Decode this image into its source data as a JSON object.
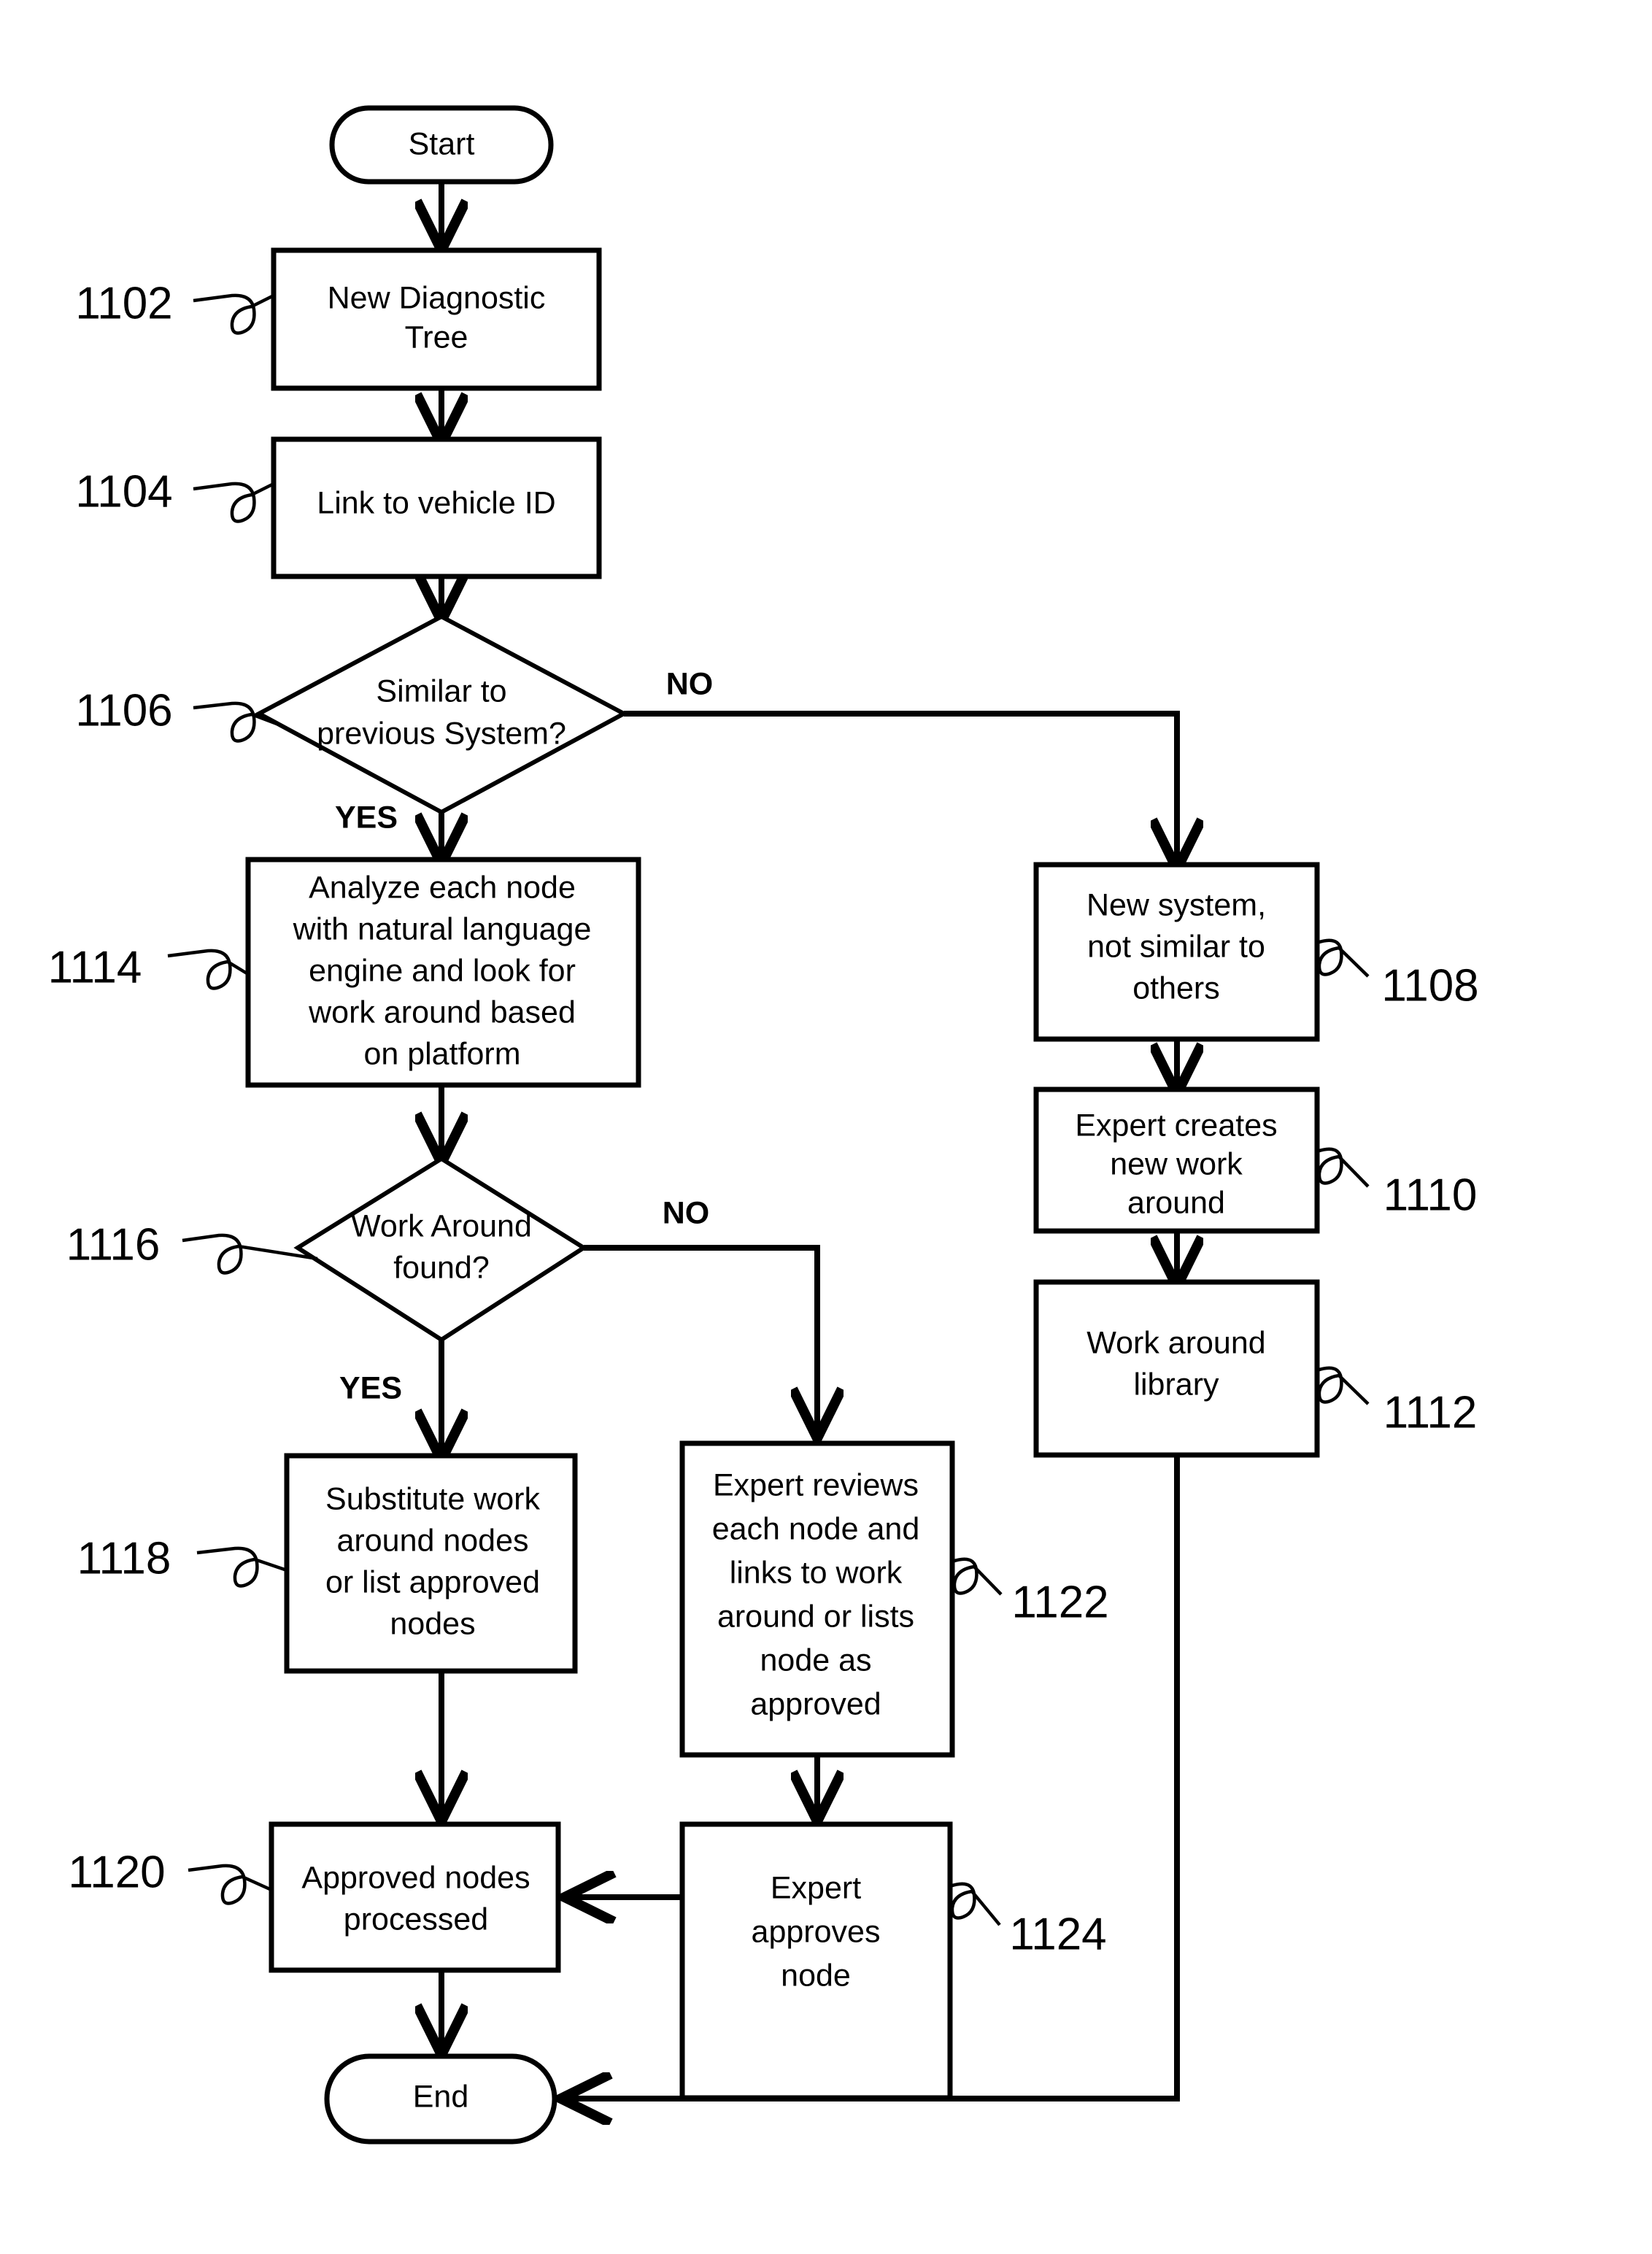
{
  "diagram": {
    "type": "flowchart",
    "title": "",
    "terminals": {
      "start": "Start",
      "end": "End"
    },
    "nodes": [
      {
        "ref": "1102",
        "label_lines": [
          "New Diagnostic",
          "Tree"
        ],
        "shape": "process"
      },
      {
        "ref": "1104",
        "label_lines": [
          "Link to vehicle ID"
        ],
        "shape": "process"
      },
      {
        "ref": "1106",
        "label_lines": [
          "Similar to",
          "previous System?"
        ],
        "shape": "decision"
      },
      {
        "ref": "1108",
        "label_lines": [
          "New system,",
          "not similar to",
          "others"
        ],
        "shape": "process"
      },
      {
        "ref": "1110",
        "label_lines": [
          "Expert creates",
          "new work",
          "around"
        ],
        "shape": "process"
      },
      {
        "ref": "1112",
        "label_lines": [
          "Work around",
          "library"
        ],
        "shape": "process"
      },
      {
        "ref": "1114",
        "label_lines": [
          "Analyze each node",
          "with natural language",
          "engine and look for",
          "work around based",
          "on platform"
        ],
        "shape": "process"
      },
      {
        "ref": "1116",
        "label_lines": [
          "Work Around",
          "found?"
        ],
        "shape": "decision"
      },
      {
        "ref": "1118",
        "label_lines": [
          "Substitute work",
          "around nodes",
          "or list approved",
          "nodes"
        ],
        "shape": "process"
      },
      {
        "ref": "1120",
        "label_lines": [
          "Approved nodes",
          "processed"
        ],
        "shape": "process"
      },
      {
        "ref": "1122",
        "label_lines": [
          "Expert reviews",
          "each node and",
          "links to work",
          "around or lists",
          "node as",
          "approved"
        ],
        "shape": "process"
      },
      {
        "ref": "1124",
        "label_lines": [
          "Expert",
          "approves",
          "node"
        ],
        "shape": "process"
      }
    ],
    "branch_labels": {
      "d1106_no": "NO",
      "d1106_yes": "YES",
      "d1116_no": "NO",
      "d1116_yes": "YES"
    },
    "colors": {
      "stroke": "#000000",
      "fill": "#ffffff",
      "text": "#000000"
    }
  }
}
